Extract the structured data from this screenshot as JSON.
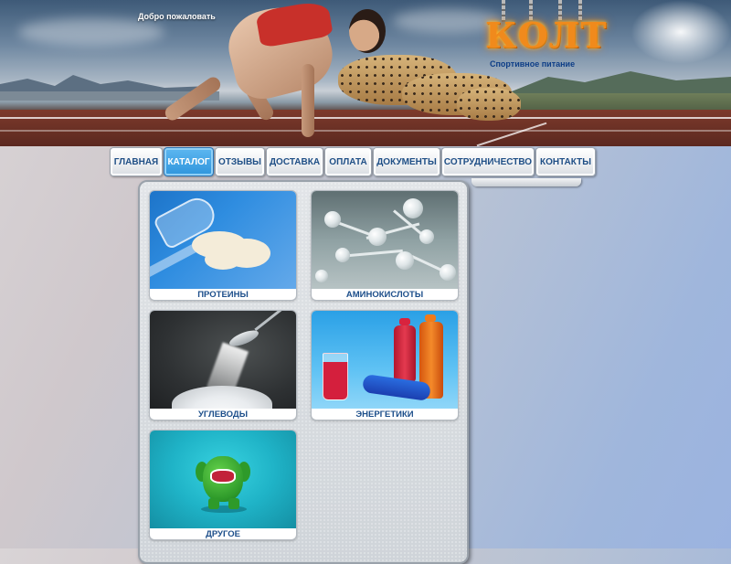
{
  "header": {
    "welcome": "Добро пожаловать",
    "logo": "КОЛТ",
    "tagline": "Спортивное питание"
  },
  "nav": {
    "items": [
      {
        "label": "ГЛАВНАЯ",
        "active": false
      },
      {
        "label": "КАТАЛОГ",
        "active": true
      },
      {
        "label": "ОТЗЫВЫ",
        "active": false
      },
      {
        "label": "ДОСТАВКА",
        "active": false
      },
      {
        "label": "ОПЛАТА",
        "active": false
      },
      {
        "label": "ДОКУМЕНТЫ",
        "active": false
      },
      {
        "label": "СОТРУДНИЧЕСТВО",
        "active": false
      },
      {
        "label": "КОНТАКТЫ",
        "active": false
      }
    ]
  },
  "catalog": {
    "categories": [
      {
        "label": "ПРОТЕИНЫ",
        "icon": "protein-powder-image"
      },
      {
        "label": "АМИНОКИСЛОТЫ",
        "icon": "molecule-image"
      },
      {
        "label": "УГЛЕВОДЫ",
        "icon": "sugar-spoon-image"
      },
      {
        "label": "ЭНЕРГЕТИКИ",
        "icon": "energy-drinks-image"
      },
      {
        "label": "ДРУГОЕ",
        "icon": "green-monster-image"
      }
    ]
  },
  "colors": {
    "nav_text": "#1f4f86",
    "nav_active_bg": "#2f95dc",
    "card_label": "#1c4e8a",
    "logo": "#f08a1c",
    "tagline": "#0e3e87"
  }
}
